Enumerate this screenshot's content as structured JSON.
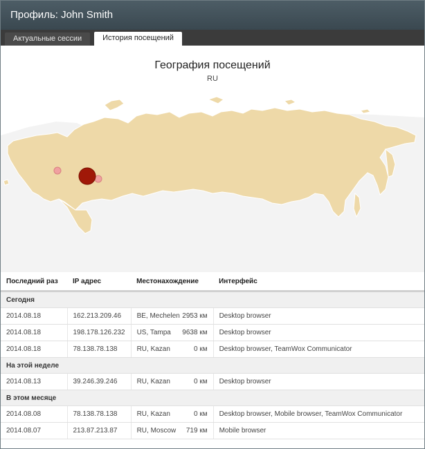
{
  "window": {
    "title": "Профиль: John Smith"
  },
  "tabs": [
    {
      "label": "Актуальные сессии",
      "active": false
    },
    {
      "label": "История посещений",
      "active": true
    }
  ],
  "map": {
    "title": "География посещений",
    "subtitle": "RU",
    "land_color": "#eed9a8",
    "ocean_color": "#f3f3f3",
    "bubble_color_strong": "#a01808",
    "bubble_color_light": "#f0a0a0"
  },
  "table": {
    "headers": [
      "Последний раз",
      "IP адрес",
      "Местонахождение",
      "Интерфейс"
    ],
    "groups": [
      {
        "label": "Сегодня",
        "rows": [
          {
            "date": "2014.08.18",
            "ip": "162.213.209.46",
            "location": "BE, Mechelen",
            "distance": "2953 км",
            "interface": "Desktop browser"
          },
          {
            "date": "2014.08.18",
            "ip": "198.178.126.232",
            "location": "US, Tampa",
            "distance": "9638 км",
            "interface": "Desktop browser"
          },
          {
            "date": "2014.08.18",
            "ip": "78.138.78.138",
            "location": "RU, Kazan",
            "distance": "0 км",
            "interface": "Desktop browser, TeamWox Communicator"
          }
        ]
      },
      {
        "label": "На этой неделе",
        "rows": [
          {
            "date": "2014.08.13",
            "ip": "39.246.39.246",
            "location": "RU, Kazan",
            "distance": "0 км",
            "interface": "Desktop browser"
          }
        ]
      },
      {
        "label": "В этом месяце",
        "rows": [
          {
            "date": "2014.08.08",
            "ip": "78.138.78.138",
            "location": "RU, Kazan",
            "distance": "0 км",
            "interface": "Desktop browser, Mobile browser, TeamWox Communicator"
          },
          {
            "date": "2014.08.07",
            "ip": "213.87.213.87",
            "location": "RU, Moscow",
            "distance": "719 км",
            "interface": "Mobile browser"
          }
        ]
      }
    ]
  }
}
